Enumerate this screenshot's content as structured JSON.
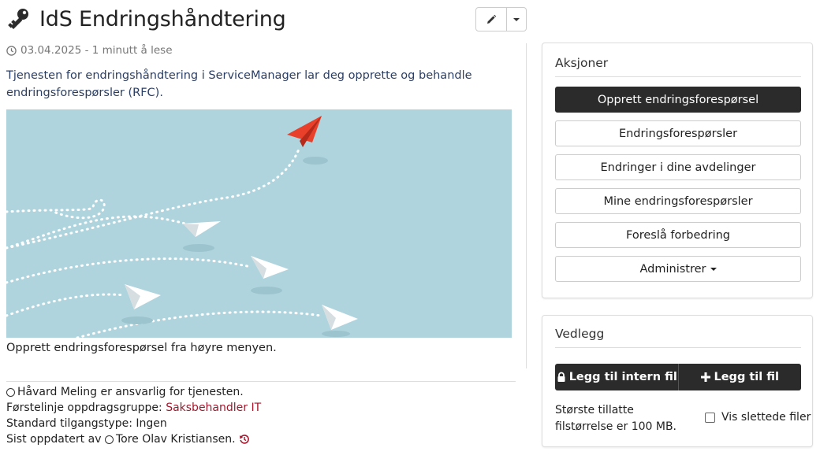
{
  "header": {
    "title": "IdS Endringshåndtering",
    "icon": "key-icon"
  },
  "meta": {
    "date": "03.04.2025",
    "separator": " - ",
    "read_time": "1 minutt å lese"
  },
  "intro": "Tjenesten for endringshåndtering i ServiceManager lar deg opprette og behandle endringsforespørsler (RFC).",
  "caption": "Opprett endringsforespørsel fra høyre menyen.",
  "footer": {
    "responsible_name": "Håvard Meling",
    "responsible_text": " er ansvarlig for tjenesten.",
    "group_label": "Førstelinje oppdragsgruppe: ",
    "group_value": "Saksbehandler IT",
    "access_label": "Standard tilgangstype: ",
    "access_value": "Ingen",
    "updated_label": "Sist oppdatert av ",
    "updated_name": "Tore Olav Kristiansen."
  },
  "actions": {
    "title": "Aksjoner",
    "buttons": [
      "Opprett endringsforespørsel",
      "Endringsforespørsler",
      "Endringer i dine avdelinger",
      "Mine endringsforespørsler",
      "Foreslå forbedring",
      "Administrer"
    ]
  },
  "attachments": {
    "title": "Vedlegg",
    "internal_button": "Legg til intern fil",
    "add_button": "Legg til fil",
    "size_note": "Største tillatte filstørrelse er 100 MB.",
    "show_deleted_label": "Vis slettede filer"
  },
  "colors": {
    "primary_button": "#2b2b2b",
    "link": "#a4152b",
    "intro_text": "#2b3e63",
    "hero_background": "#afd4dd",
    "red_plane": "#e8402b"
  }
}
